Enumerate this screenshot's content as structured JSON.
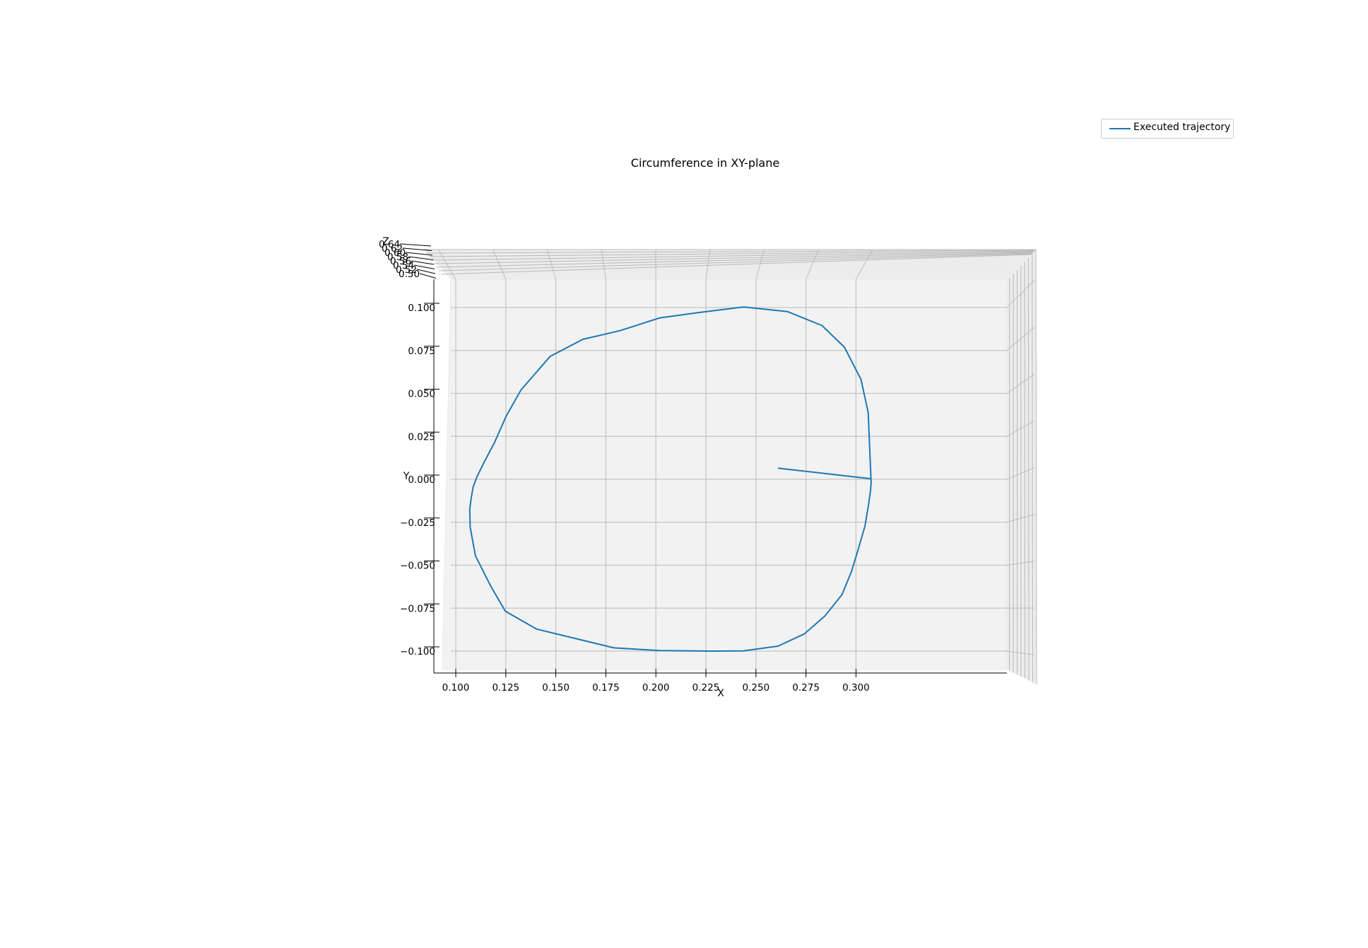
{
  "chart_data": {
    "type": "line",
    "title": "Circumference in XY-plane",
    "xlabel": "X",
    "ylabel": "Y",
    "zlabel": "Z",
    "xlim": [
      0.096,
      0.3225
    ],
    "ylim": [
      -0.1155,
      0.1155
    ],
    "x_ticks": [
      "0.100",
      "0.125",
      "0.150",
      "0.175",
      "0.200",
      "0.225",
      "0.250",
      "0.275",
      "0.300"
    ],
    "y_ticks": [
      "−0.100",
      "−0.075",
      "−0.050",
      "−0.025",
      "0.000",
      "0.025",
      "0.050",
      "0.075",
      "0.100"
    ],
    "z_ticks": [
      "0.64",
      "0.62",
      "0.60",
      "0.58",
      "0.56",
      "0.54",
      "0.52",
      "0.50"
    ],
    "grid": true,
    "legend_placement": "top-right",
    "series": [
      {
        "name": "Executed trajectory",
        "color": "#1f77b4",
        "x": [
          0.261,
          0.3075,
          0.3076,
          0.3072,
          0.3063,
          0.3045,
          0.3015,
          0.2978,
          0.293,
          0.2845,
          0.2742,
          0.261,
          0.2435,
          0.2265,
          0.2018,
          0.179,
          0.1588,
          0.1404,
          0.1248,
          0.1173,
          0.1098,
          0.1072,
          0.107,
          0.1078,
          0.1087,
          0.1104,
          0.1138,
          0.1193,
          0.1253,
          0.1326,
          0.1471,
          0.1635,
          0.182,
          0.202,
          0.2218,
          0.2438,
          0.2658,
          0.283,
          0.2942,
          0.3025,
          0.3061,
          0.3075
        ],
        "y": [
          0.0065,
          0.0003,
          -0.002,
          -0.0072,
          -0.0148,
          -0.0272,
          -0.0393,
          -0.0535,
          -0.0671,
          -0.0795,
          -0.09,
          -0.0971,
          -0.0999,
          -0.1,
          -0.0997,
          -0.0981,
          -0.0924,
          -0.0872,
          -0.0768,
          -0.0618,
          -0.0445,
          -0.0278,
          -0.0172,
          -0.0102,
          -0.0045,
          0.001,
          0.0091,
          0.0213,
          0.037,
          0.052,
          0.0715,
          0.0815,
          0.0865,
          0.094,
          0.0971,
          0.1003,
          0.0976,
          0.0895,
          0.0769,
          0.0581,
          0.0388,
          0.0003
        ]
      }
    ]
  }
}
